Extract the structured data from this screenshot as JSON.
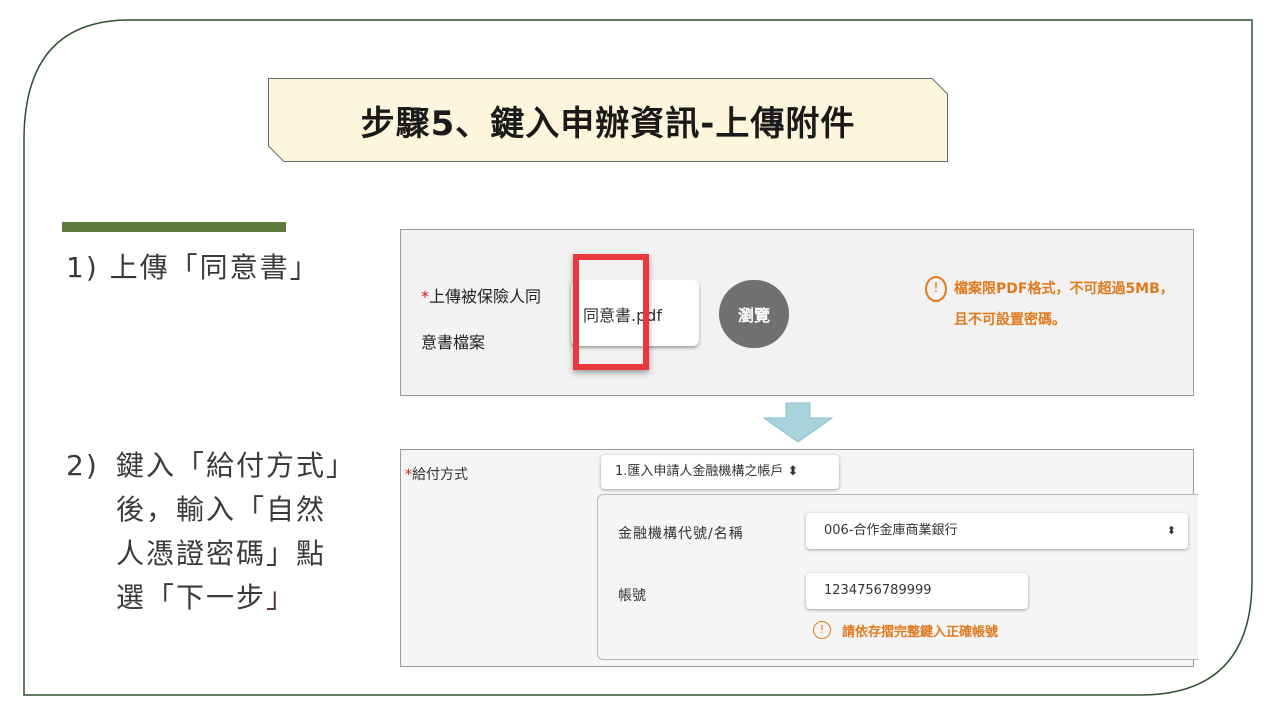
{
  "slide": {
    "title": "步驟5、鍵入申辦資訊-上傳附件",
    "steps": {
      "step1": "1)  上傳「同意書」",
      "step2_num": "2)",
      "step2_line1": "鍵入「給付方式」",
      "step2_line2": "後，輸入「自然",
      "step2_line3": "人憑證密碼」點",
      "step2_line4a": "選「下一步",
      "step2_line4b": "」"
    }
  },
  "upload_panel": {
    "required_mark": "*",
    "label": "上傳被保險人同意書檔案",
    "file_value": "同意書.pdf",
    "browse_label": "瀏覽",
    "warning_icon": "!",
    "warning_text": "檔案限PDF格式，不可超過5MB，且不可設置密碼。"
  },
  "payment_panel": {
    "required_mark": "*",
    "label": "給付方式",
    "method_value": "1.匯入申請人金融機構之帳戶 ⬍",
    "bank_label": "金融機構代號/名稱",
    "bank_value": "006-合作金庫商業銀行",
    "caret": "⬍",
    "account_label": "帳號",
    "account_value": "1234756789999",
    "warning_icon": "!",
    "warning_text": "請依存摺完整鍵入正確帳號"
  },
  "colors": {
    "accent": "#5c7a3a",
    "title_bg": "#fdf6dc",
    "highlight": "#e8383d",
    "warning": "#e07a1f",
    "arrow": "#a9d3dc"
  }
}
